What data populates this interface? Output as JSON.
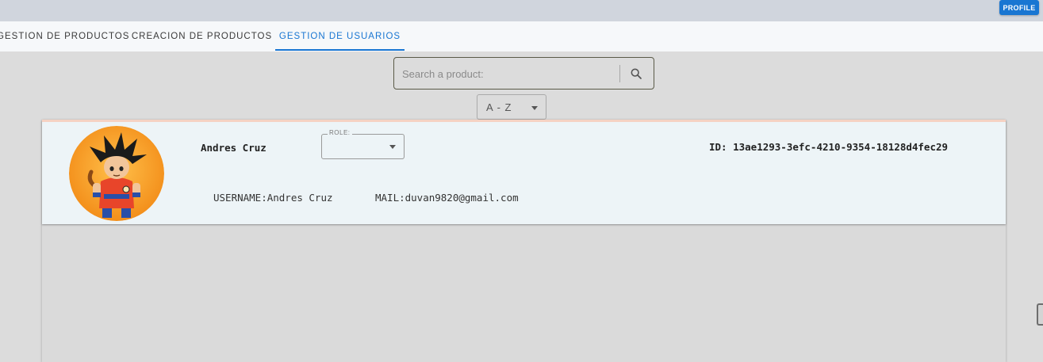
{
  "header": {
    "profile_label": "PROFILE",
    "accent_color": "#1976d2"
  },
  "tabs": [
    {
      "label": "GESTION DE PRODUCTOS",
      "active": false
    },
    {
      "label": "CREACION DE PRODUCTOS",
      "active": false
    },
    {
      "label": "GESTION DE USUARIOS",
      "active": true
    }
  ],
  "search": {
    "placeholder": "Search a product:",
    "value": "",
    "icon": "search-icon"
  },
  "sort": {
    "selected": "A - Z"
  },
  "user_card": {
    "name": "Andres Cruz",
    "role_label": "ROLE:",
    "role_value": "",
    "id_text": "ID: 13ae1293-3efc-4210-9354-18128d4fec29",
    "username_text": "USERNAME:Andres Cruz",
    "mail_text": "MAIL:duvan9820@gmail.com",
    "avatar": "cartoon-character-avatar"
  }
}
